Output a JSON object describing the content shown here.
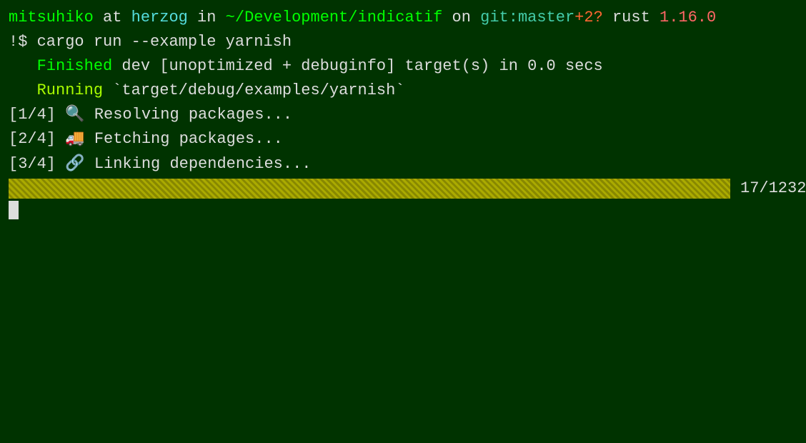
{
  "terminal": {
    "prompt_user": "mitsuhiko",
    "prompt_at": " at ",
    "prompt_host": "herzog",
    "prompt_in": " in ",
    "prompt_path": "~/Development/indicatif",
    "prompt_on": " on ",
    "prompt_git_label": "git:",
    "prompt_git_branch": "master",
    "prompt_git_status": "+2?",
    "prompt_rust_label": " rust ",
    "prompt_rust_version": "1.16.0",
    "command_prefix": "!$ ",
    "command_text": "cargo run --example yarnish",
    "finished_label": "Finished",
    "finished_rest": " dev [unoptimized + debuginfo] target(s) in 0.0 secs",
    "running_label": "Running",
    "running_rest": " `target/debug/examples/yarnish`",
    "step1_prefix": "[1/4]",
    "step1_icon": "🔍",
    "step1_text": " Resolving packages...",
    "step2_prefix": "[2/4]",
    "step2_icon": "🚚",
    "step2_text": " Fetching packages...",
    "step3_prefix": "[3/4]",
    "step3_icon": "🔗",
    "step3_text": " Linking dependencies...",
    "progress_value": "17",
    "progress_total": "1232",
    "progress_display": "17/1232"
  }
}
